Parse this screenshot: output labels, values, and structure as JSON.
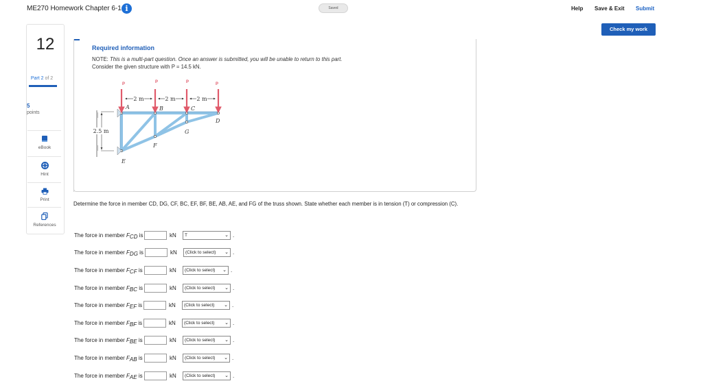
{
  "header": {
    "title": "ME270 Homework Chapter 6-1",
    "info_icon": "i",
    "saved": "Saved",
    "help": "Help",
    "save_exit": "Save & Exit",
    "submit": "Submit",
    "check": "Check my work"
  },
  "sidebar": {
    "question_number": "12",
    "part_label": "Part 2",
    "part_of": "of 2",
    "points": "5",
    "points_label": "points",
    "tools": [
      {
        "label": "eBook",
        "icon": "book-icon"
      },
      {
        "label": "Hint",
        "icon": "lifebuoy-icon"
      },
      {
        "label": "Print",
        "icon": "printer-icon"
      },
      {
        "label": "References",
        "icon": "copy-icon"
      }
    ]
  },
  "info": {
    "title": "Required information",
    "note_prefix": "NOTE: ",
    "note_italic": "This is a multi-part question. Once an answer is submitted, you will be unable to return to this part.",
    "given": "Consider the given structure with P = 14.5 kN."
  },
  "figure": {
    "load": "P",
    "spans": [
      "2 m",
      "2 m",
      "2 m"
    ],
    "height": "2.5 m",
    "nodes": [
      "A",
      "B",
      "C",
      "D",
      "E",
      "F",
      "G"
    ]
  },
  "question": {
    "text": "Determine the force in member CD, DG, CF, BC, EF, BF, BE, AB, AE, and FG of the truss shown. State whether each member is in tension (T) or compression (C)."
  },
  "answers": {
    "prefix": "The force in member ",
    "suffix": " is",
    "unit": "kN",
    "rows": [
      {
        "member": "F",
        "sub": "CD",
        "value": "",
        "select": "T"
      },
      {
        "member": "F",
        "sub": "DG",
        "value": "",
        "select": "(Click to select)"
      },
      {
        "member": "F",
        "sub": "CF",
        "value": "",
        "select": "(Click to select)"
      },
      {
        "member": "F",
        "sub": "BC",
        "value": "",
        "select": "(Click to select)"
      },
      {
        "member": "F",
        "sub": "EF",
        "value": "",
        "select": "(Click to select)"
      },
      {
        "member": "F",
        "sub": "BF",
        "value": "",
        "select": "(Click to select)"
      },
      {
        "member": "F",
        "sub": "BE",
        "value": "",
        "select": "(Click to select)"
      },
      {
        "member": "F",
        "sub": "AB",
        "value": "",
        "select": "(Click to select)"
      },
      {
        "member": "F",
        "sub": "AE",
        "value": "",
        "select": "(Click to select)"
      }
    ]
  },
  "colors": {
    "accent": "#1f5fb8",
    "truss": "#8fc3e6",
    "load_arrow": "#e05a6a"
  }
}
